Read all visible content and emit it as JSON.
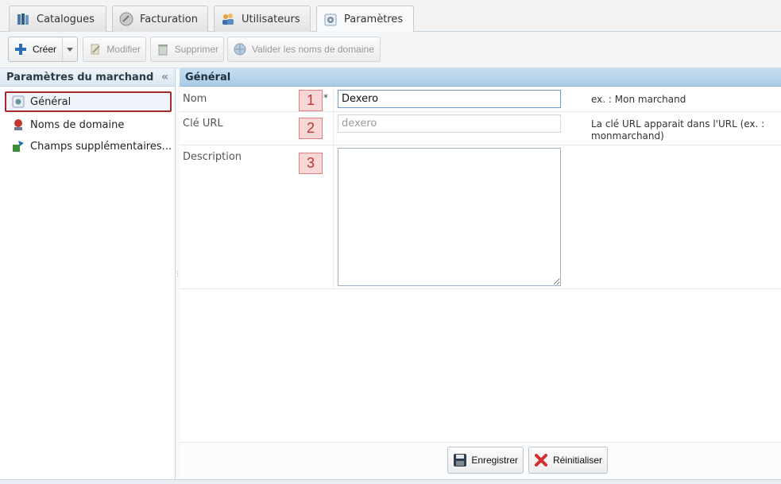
{
  "tabs": [
    {
      "label": "Catalogues",
      "icon": "catalog-books-icon"
    },
    {
      "label": "Facturation",
      "icon": "billing-disc-icon"
    },
    {
      "label": "Utilisateurs",
      "icon": "users-icon"
    },
    {
      "label": "Paramètres",
      "icon": "settings-gear-icon",
      "active": true
    }
  ],
  "toolbar": {
    "create_label": "Créer",
    "edit_label": "Modifier",
    "delete_label": "Supprimer",
    "validate_label": "Valider les noms de domaine"
  },
  "left_panel": {
    "title": "Paramètres du marchand",
    "collapse_glyph": "«",
    "items": [
      {
        "label": "Général",
        "icon": "general-settings-icon",
        "selected": true
      },
      {
        "label": "Noms de domaine",
        "icon": "domain-names-icon"
      },
      {
        "label": "Champs supplémentaires...",
        "icon": "extra-fields-icon"
      }
    ]
  },
  "main": {
    "title": "Général",
    "fields": [
      {
        "label": "Nom",
        "required_mark": "*",
        "badge": "1",
        "value": "Dexero",
        "hint": "ex. : Mon marchand"
      },
      {
        "label": "Clé URL",
        "badge": "2",
        "placeholder": "dexero",
        "hint": "La clé URL apparait dans l'URL (ex. : monmarchand)"
      },
      {
        "label": "Description",
        "badge": "3",
        "value": ""
      }
    ]
  },
  "footer": {
    "save_label": "Enregistrer",
    "reset_label": "Réinitialiser"
  },
  "colors": {
    "header_blue": "#a9cbe6",
    "selection_border": "#a52a2a",
    "badge_bg": "#f9d7d7",
    "badge_text": "#b33333"
  }
}
